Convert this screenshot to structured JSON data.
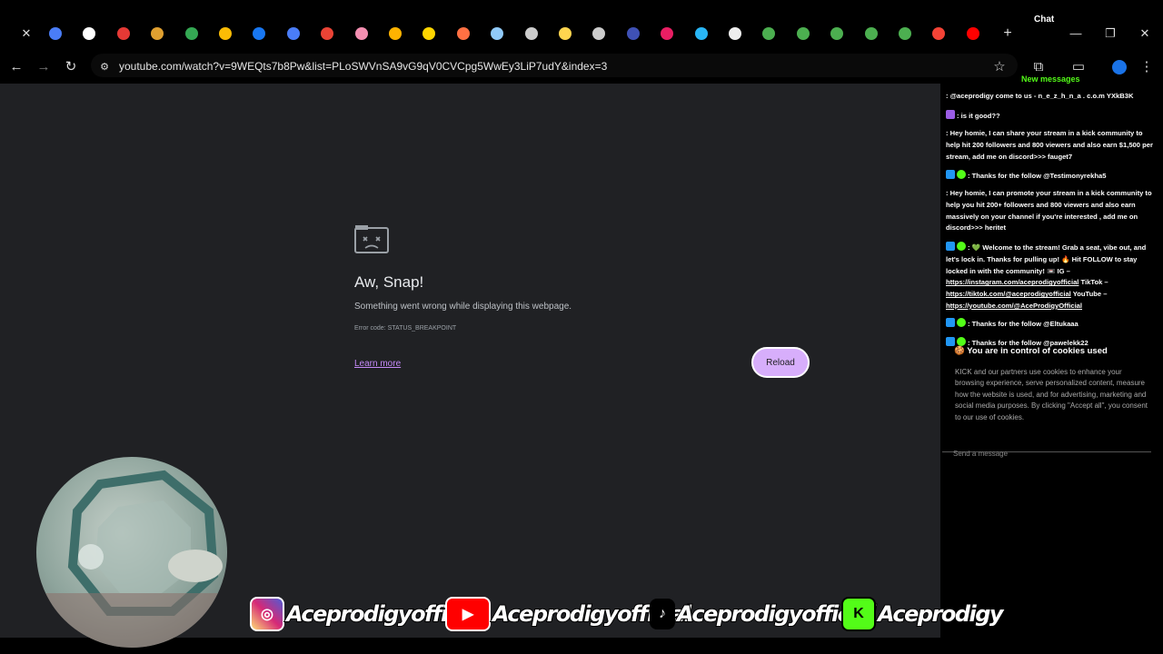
{
  "tabs": {
    "items": [
      {
        "icon": "docs-icon",
        "color": "#4a7df7"
      },
      {
        "icon": "circle-logo-icon",
        "color": "#ffffff"
      },
      {
        "icon": "live-icon",
        "color": "#e53935"
      },
      {
        "icon": "slack-icon",
        "color": "#e0a030"
      },
      {
        "icon": "drive-icon",
        "color": "#34a853"
      },
      {
        "icon": "drive-icon",
        "color": "#fbbc05"
      },
      {
        "icon": "meta-icon",
        "color": "#1877f2"
      },
      {
        "icon": "docs-icon",
        "color": "#4a7df7"
      },
      {
        "icon": "gmail-icon",
        "color": "#ea4335"
      },
      {
        "icon": "m-icon",
        "color": "#f48fb1"
      },
      {
        "icon": "triangle-icon",
        "color": "#ffb300"
      },
      {
        "icon": "m-yellow-icon",
        "color": "#ffd600"
      },
      {
        "icon": "gradient-icon",
        "color": "#ff7043"
      },
      {
        "icon": "v-icon",
        "color": "#90caf9"
      },
      {
        "icon": "ace-icon",
        "color": "#cccccc"
      },
      {
        "icon": "ace-icon",
        "color": "#ffd54f"
      },
      {
        "icon": "ace-icon",
        "color": "#cccccc"
      },
      {
        "icon": "circle-blue-icon",
        "color": "#3f51b5"
      },
      {
        "icon": "squiggle-icon",
        "color": "#e91e63"
      },
      {
        "icon": "square-blue-icon",
        "color": "#29b6f6"
      },
      {
        "icon": "white-circle-icon",
        "color": "#eeeeee"
      },
      {
        "icon": "plus-green-icon",
        "color": "#4caf50"
      },
      {
        "icon": "plus-green-icon",
        "color": "#4caf50"
      },
      {
        "icon": "plus-green-icon",
        "color": "#4caf50"
      },
      {
        "icon": "plus-green-icon",
        "color": "#4caf50"
      },
      {
        "icon": "plus-green-icon",
        "color": "#4caf50"
      },
      {
        "icon": "red-circle-icon",
        "color": "#f44336"
      },
      {
        "icon": "youtube-icon",
        "color": "#ff0000"
      }
    ],
    "new_tab_label": "+"
  },
  "window": {
    "chat_label": "Chat",
    "minimize": "—",
    "restore": "❐",
    "close": "✕"
  },
  "toolbar": {
    "back": "←",
    "forward": "→",
    "reload": "↻",
    "url": "youtube.com/watch?v=9WEQts7b8Pw&list=PLoSWVnSA9vG9qV0CVCpg5WwEy3LiP7udY&index=3"
  },
  "error_page": {
    "title": "Aw, Snap!",
    "message": "Something went wrong while displaying this webpage.",
    "code": "Error code: STATUS_BREAKPOINT",
    "learn_more": "Learn more",
    "reload": "Reload"
  },
  "chat": {
    "new_messages": "New messages",
    "messages": [
      {
        "text": ": @aceprodigy come to us - n_e_z_h_n_a . c.o.m YXkB3K",
        "badges": []
      },
      {
        "text": ": is it good??",
        "badges": [
          "#9b5de5"
        ]
      },
      {
        "text": ": Hey homie, I can share your stream in a kick community to help hit 200 followers and 800 viewers and also earn $1,500 per stream, add me on discord>>> fauget7",
        "badges": []
      },
      {
        "text": ": Thanks for the follow @Testimonyrekha5",
        "badges": [
          "#2196f3",
          "#53fc18"
        ]
      },
      {
        "text": ": Hey homie, I can promote your stream in a kick community to help you hit 200+ followers and 800 viewers and also earn massively on your channel if you're interested , add me on discord>>> heritet",
        "badges": []
      },
      {
        "text": ": 💚 Welcome to the stream! Grab a seat, vibe out, and let's lock in. Thanks for pulling up! 🔥 Hit FOLLOW to stay locked in with the community! 📼 IG –",
        "badges": [
          "#2196f3",
          "#53fc18"
        ]
      },
      {
        "text": ": Thanks for the follow @Eltukaaa",
        "badges": [
          "#2196f3",
          "#53fc18"
        ]
      },
      {
        "text": ": Thanks for the follow @pawelekk22",
        "badges": [
          "#2196f3",
          "#53fc18"
        ]
      }
    ],
    "links": {
      "instagram": "https://instagram.com/aceprodigyofficial",
      "tiktok_label": "TikTok –",
      "tiktok": "https://tiktok.com/@aceprodigyofficial",
      "youtube_label": "YouTube –",
      "youtube": "https://youtube.com/@AceProdigyOfficial"
    },
    "cookie_title": "You are in control of cookies used",
    "cookie_text": "KICK and our partners use cookies to enhance your browsing experience, serve personalized content, measure how the website is used, and for advertising, marketing and social media purposes. By clicking \"Accept all\", you consent to our use of cookies.",
    "send_placeholder": "Send a message"
  },
  "overlay": {
    "socials": [
      {
        "platform": "instagram-icon",
        "handle": "Aceprodigyofficial",
        "color": "#d6249f"
      },
      {
        "platform": "youtube-icon",
        "handle": "Aceprodigyofficial",
        "color": "#ff0000"
      },
      {
        "platform": "tiktok-icon",
        "handle": "Aceprodigyofficial",
        "color": "#000000"
      },
      {
        "platform": "kick-icon",
        "handle": "Aceprodigy",
        "color": "#53fc18"
      }
    ]
  }
}
